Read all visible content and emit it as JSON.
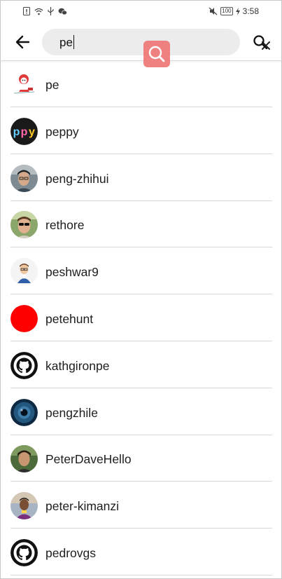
{
  "status_bar": {
    "battery": "100",
    "time": "3:58"
  },
  "search": {
    "query": "pe"
  },
  "results": [
    {
      "username": "pe",
      "avatar": "mascot-avatar"
    },
    {
      "username": "peppy",
      "avatar": "ppy-logo-avatar"
    },
    {
      "username": "peng-zhihui",
      "avatar": "person-photo-avatar"
    },
    {
      "username": "rethore",
      "avatar": "sunglasses-photo-avatar"
    },
    {
      "username": "peshwar9",
      "avatar": "cartoon-avatar"
    },
    {
      "username": "petehunt",
      "avatar": "red-circle-avatar"
    },
    {
      "username": "kathgironpe",
      "avatar": "github-logo-avatar"
    },
    {
      "username": "pengzhile",
      "avatar": "blue-eye-avatar"
    },
    {
      "username": "PeterDaveHello",
      "avatar": "person-photo-avatar"
    },
    {
      "username": "peter-kimanzi",
      "avatar": "person-photo-avatar"
    },
    {
      "username": "pedrovgs",
      "avatar": "github-logo-avatar"
    }
  ],
  "colors": {
    "overlay": "#f07b7b",
    "search_bg": "#ececec",
    "divider": "#d7d7d7"
  }
}
